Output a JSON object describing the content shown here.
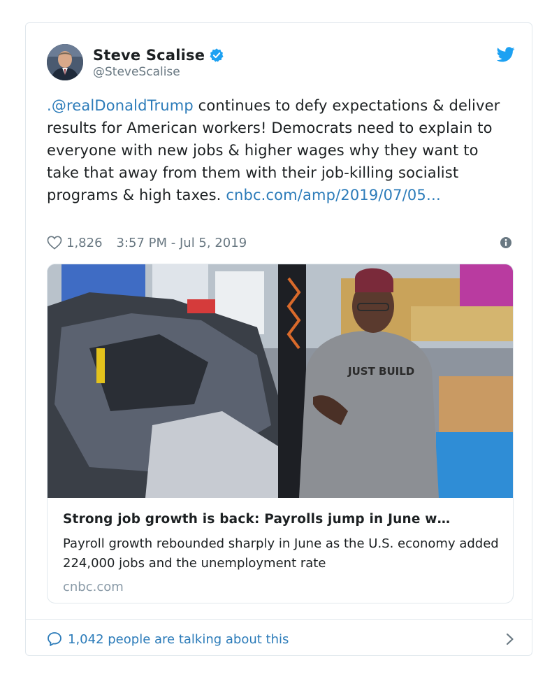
{
  "author": {
    "display_name": "Steve Scalise",
    "handle": "@SteveScalise",
    "verified": true
  },
  "tweet": {
    "mention": ".@realDonaldTrump",
    "body": " continues to defy expectations & deliver results for American workers! Democrats need to explain to everyone with new jobs & higher wages why they want to take that away from them with their job-killing socialist programs & high taxes. ",
    "url_text": "cnbc.com/amp/2019/07/05…"
  },
  "meta": {
    "likes": "1,826",
    "timestamp": "3:57 PM - Jul 5, 2019"
  },
  "card": {
    "title": "Strong job growth is back: Payrolls jump in June w…",
    "description": "Payroll growth rebounded sharply in June as the U.S. economy added 224,000 jobs and the unemployment rate",
    "domain": "cnbc.com",
    "shirt_text": "JUST BUILD"
  },
  "footer": {
    "conversation": "1,042 people are talking about this"
  },
  "colors": {
    "link": "#2b7bb9",
    "verified": "#1da1f2",
    "muted": "#697882",
    "border": "#e1e8ed"
  },
  "icons": {
    "verified": "verified-badge-icon",
    "bird": "twitter-bird-icon",
    "heart": "heart-icon",
    "info": "info-icon",
    "bubble": "speech-bubble-icon",
    "chevron": "chevron-right-icon"
  }
}
